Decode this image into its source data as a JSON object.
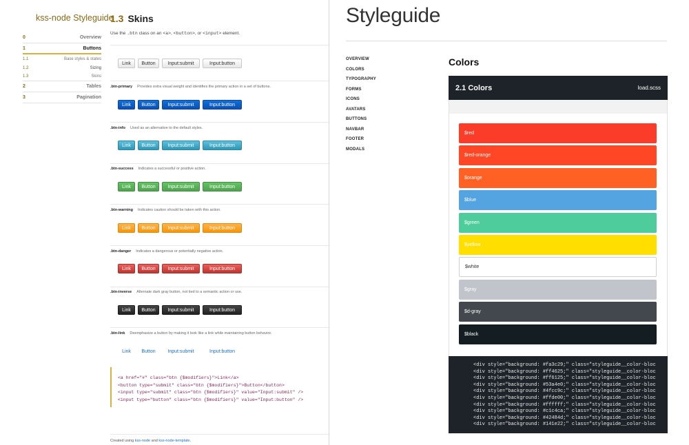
{
  "left": {
    "title": "kss-node Styleguide",
    "nav": [
      {
        "num": "0",
        "label": "Overview",
        "type": "main"
      },
      {
        "num": "1",
        "label": "Buttons",
        "type": "main",
        "active": true
      },
      {
        "num": "1.1",
        "label": "Base styles & states",
        "type": "sub"
      },
      {
        "num": "1.2",
        "label": "Sizing",
        "type": "sub"
      },
      {
        "num": "1.3",
        "label": "Skins",
        "type": "sub"
      },
      {
        "num": "2",
        "label": "Tables",
        "type": "main"
      },
      {
        "num": "3",
        "label": "Pagination",
        "type": "main"
      }
    ],
    "section": {
      "num": "1.3",
      "title": "Skins",
      "desc_pre": "Use the ",
      "desc_code1": ".btn",
      "desc_mid": " class on an ",
      "desc_code2": "<a>",
      "desc_sep1": ", ",
      "desc_code3": "<button>",
      "desc_sep2": ", or ",
      "desc_code4": "<input>",
      "desc_post": " element."
    },
    "button_labels": [
      "Link",
      "Button",
      "Input:submit",
      "Input:button"
    ],
    "modifiers": [
      {
        "name": ".btn-primary",
        "desc": "Provides extra visual weight and identifies the primary action in a set of buttons."
      },
      {
        "name": ".btn-info",
        "desc": "Used as an alternative to the default styles."
      },
      {
        "name": ".btn-success",
        "desc": "Indicates a successful or positive action."
      },
      {
        "name": ".btn-warning",
        "desc": "Indicates caution should be taken with this action."
      },
      {
        "name": ".btn-danger",
        "desc": "Indicates a dangerous or potentially negative action."
      },
      {
        "name": ".btn-inverse",
        "desc": "Alternate dark gray button, not tied to a semantic action or use."
      },
      {
        "name": ".btn-link",
        "desc": "Deemphasize a button by making it look like a link while maintaining button behavior."
      }
    ],
    "code": [
      "<a href=\"#\" class=\"btn {$modifiers}\">Link</a>",
      "<button type=\"submit\" class=\"btn {$modifiers}\">Button</button>",
      "<input type=\"submit\" class=\"btn {$modifiers}\" value=\"Input:submit\" />",
      "<input type=\"button\" class=\"btn {$modifiers}\" value=\"Input:button\" />"
    ],
    "footer": {
      "pre": "Created using ",
      "link1": "kss-node",
      "mid": " and ",
      "link2": "kss-node-template",
      "post": "."
    }
  },
  "right": {
    "title": "Styleguide",
    "nav": [
      "OVERVIEW",
      "COLORS",
      "TYPOGRAPHY",
      "FORMS",
      "ICONS",
      "AVATARS",
      "BUTTONS",
      "NAVBAR",
      "FOOTER",
      "MODALS"
    ],
    "heading": "Colors",
    "panel_title": "2.1 Colors",
    "panel_file": "load.scss",
    "swatches": [
      {
        "name": "$red",
        "color": "#fa3c29"
      },
      {
        "name": "$red-orange",
        "color": "#ff4625"
      },
      {
        "name": "$orange",
        "color": "#ff6125"
      },
      {
        "name": "$blue",
        "color": "#53a4e0"
      },
      {
        "name": "$green",
        "color": "#4fcc9c"
      },
      {
        "name": "$yellow",
        "color": "#ffde00"
      },
      {
        "name": "$white",
        "color": "#ffffff"
      },
      {
        "name": "$gray",
        "color": "#c1c4ca"
      },
      {
        "name": "$d-gray",
        "color": "#42484d"
      },
      {
        "name": "$black",
        "color": "#141e22"
      }
    ],
    "code": [
      "<div style=\"background: #fa3c29;\" class=\"styleguide__color-bloc",
      "<div style=\"background: #ff4625;\" class=\"styleguide__color-bloc",
      "<div style=\"background: #ff6125;\" class=\"styleguide__color-bloc",
      "<div style=\"background: #53a4e0;\" class=\"styleguide__color-bloc",
      "<div style=\"background: #4fcc9c;\" class=\"styleguide__color-bloc",
      "<div style=\"background: #ffde00;\" class=\"styleguide__color-bloc",
      "<div style=\"background: #ffffff;\" class=\"styleguide__color-bloc",
      "<div style=\"background: #c1c4ca;\" class=\"styleguide__color-bloc",
      "<div style=\"background: #42484d;\" class=\"styleguide__color-bloc",
      "<div style=\"background: #141e22;\" class=\"styleguide__color-bloc"
    ]
  }
}
